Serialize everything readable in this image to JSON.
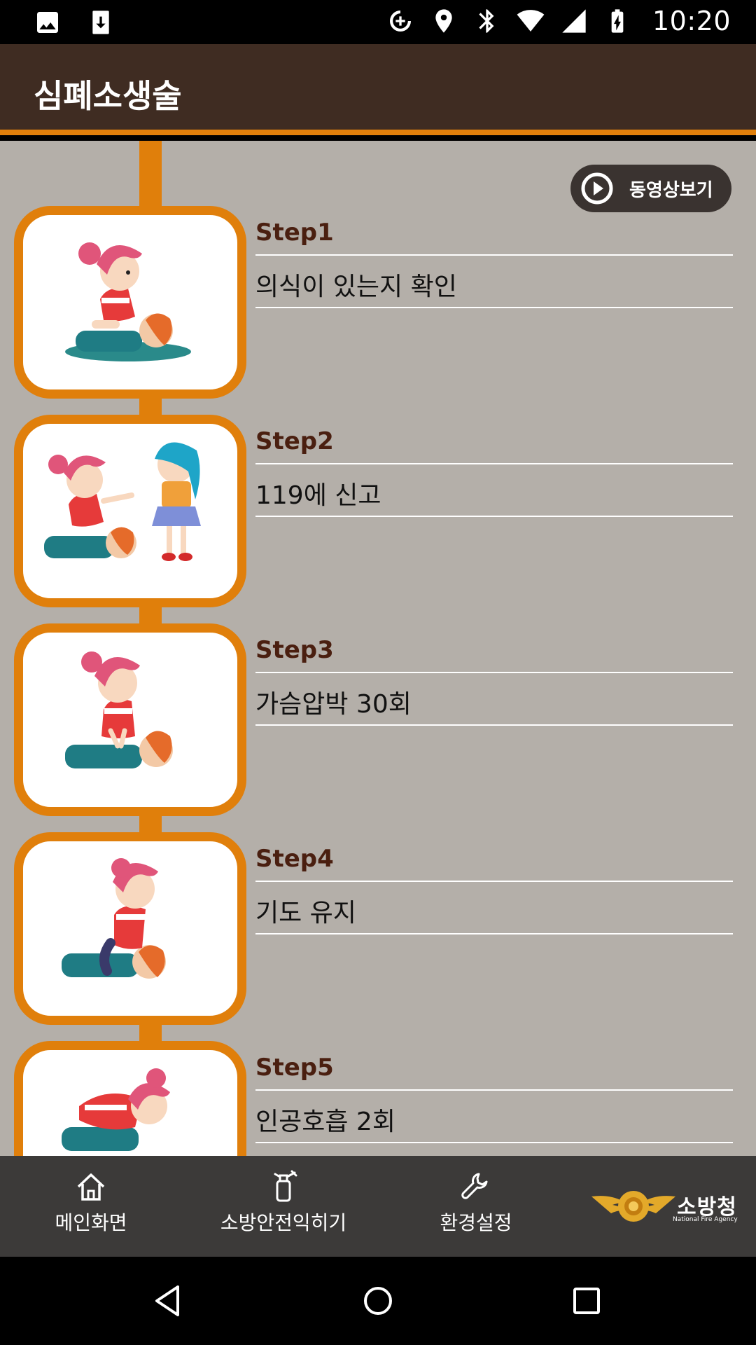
{
  "status_bar": {
    "time": "10:20",
    "left_icons": [
      "image-icon",
      "download-icon"
    ],
    "right_icons": [
      "data-saver-icon",
      "location-icon",
      "bluetooth-icon",
      "wifi-icon",
      "signal-icon",
      "battery-icon"
    ]
  },
  "app_bar": {
    "title": "심폐소생술"
  },
  "video_button": {
    "label": "동영상보기",
    "icon": "play-icon"
  },
  "steps": [
    {
      "title": "Step1",
      "desc": "의식이 있는지 확인"
    },
    {
      "title": "Step2",
      "desc": "119에 신고"
    },
    {
      "title": "Step3",
      "desc": "가슴압박 30회"
    },
    {
      "title": "Step4",
      "desc": "기도 유지"
    },
    {
      "title": "Step5",
      "desc": "인공호흡 2회"
    }
  ],
  "bottom_nav": {
    "items": [
      {
        "label": "메인화면",
        "icon": "home-icon"
      },
      {
        "label": "소방안전익히기",
        "icon": "fire-extinguisher-icon"
      },
      {
        "label": "환경설정",
        "icon": "wrench-icon"
      }
    ],
    "logo": {
      "text": "소방청",
      "subtext": "National Fire Agency"
    }
  },
  "system_nav": [
    "back-icon",
    "home-circle-icon",
    "recents-icon"
  ],
  "colors": {
    "app_bar": "#3f2c22",
    "accent": "#e07f0b",
    "content_bg": "#b4afa9",
    "step_title": "#4a1f10",
    "bottom_nav": "#3c3a39"
  }
}
